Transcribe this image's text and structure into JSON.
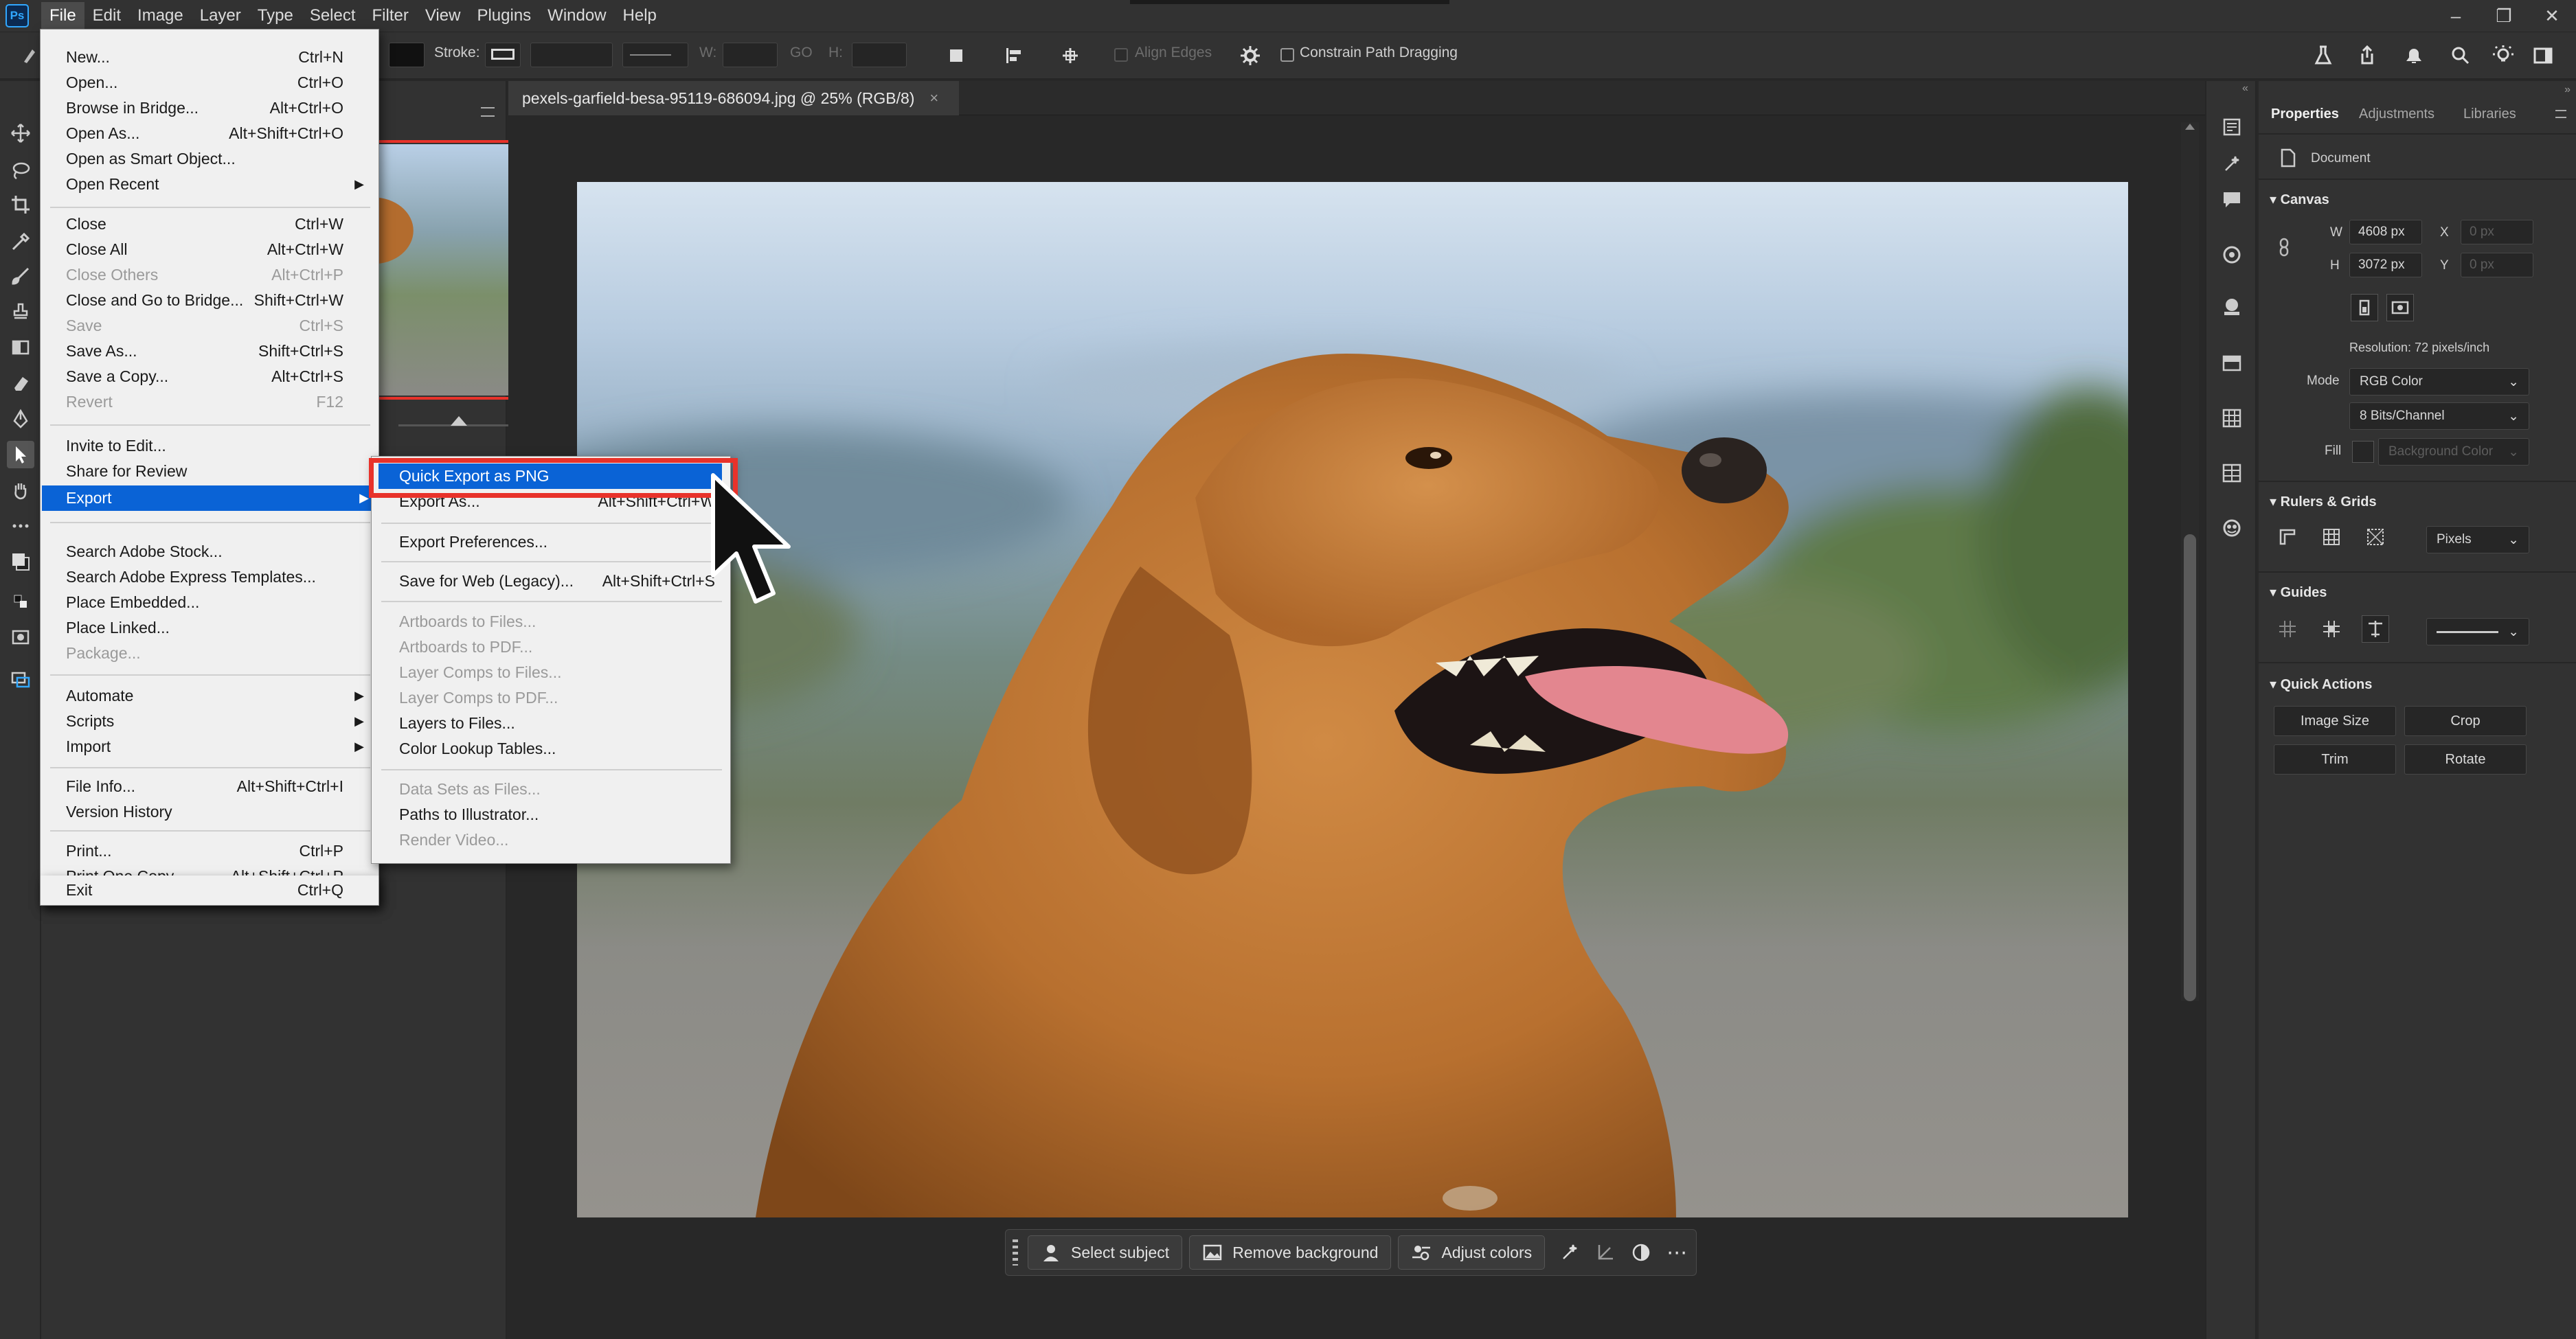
{
  "menubar": {
    "items": [
      "File",
      "Edit",
      "Image",
      "Layer",
      "Type",
      "Select",
      "Filter",
      "View",
      "Plugins",
      "Window",
      "Help"
    ]
  },
  "options_bar": {
    "stroke_label": "Stroke:",
    "w_label": "W:",
    "h_label": "H:",
    "align_edges": "Align Edges",
    "constrain_path": "Constrain Path Dragging"
  },
  "document": {
    "tab_title": "pexels-garfield-besa-95119-686094.jpg @ 25% (RGB/8)",
    "tab_close": "×"
  },
  "taskbar": {
    "select_subject": "Select subject",
    "remove_background": "Remove background",
    "adjust_colors": "Adjust colors",
    "more": "⋯"
  },
  "properties": {
    "tabs": [
      "Properties",
      "Adjustments",
      "Libraries"
    ],
    "document_label": "Document",
    "canvas_title": "Canvas",
    "w_label": "W",
    "w_value": "4608 px",
    "h_label": "H",
    "h_value": "3072 px",
    "x_label": "X",
    "x_value": "0 px",
    "y_label": "Y",
    "y_value": "0 px",
    "resolution": "Resolution: 72 pixels/inch",
    "mode_label": "Mode",
    "mode_value": "RGB Color",
    "bits_value": "8 Bits/Channel",
    "fill_label": "Fill",
    "fill_value": "Background Color",
    "rulers_title": "Rulers & Grids",
    "rulers_unit": "Pixels",
    "guides_title": "Guides",
    "quick_actions_title": "Quick Actions",
    "image_size": "Image Size",
    "crop": "Crop",
    "trim": "Trim",
    "rotate": "Rotate"
  },
  "file_menu": {
    "items": [
      {
        "label": "New...",
        "shortcut": "Ctrl+N"
      },
      {
        "label": "Open...",
        "shortcut": "Ctrl+O"
      },
      {
        "label": "Browse in Bridge...",
        "shortcut": "Alt+Ctrl+O"
      },
      {
        "label": "Open As...",
        "shortcut": "Alt+Shift+Ctrl+O"
      },
      {
        "label": "Open as Smart Object...",
        "shortcut": ""
      },
      {
        "label": "Open Recent",
        "shortcut": ""
      },
      {
        "label": "Close",
        "shortcut": "Ctrl+W"
      },
      {
        "label": "Close All",
        "shortcut": "Alt+Ctrl+W"
      },
      {
        "label": "Close Others",
        "shortcut": "Alt+Ctrl+P"
      },
      {
        "label": "Close and Go to Bridge...",
        "shortcut": "Shift+Ctrl+W"
      },
      {
        "label": "Save",
        "shortcut": "Ctrl+S"
      },
      {
        "label": "Save As...",
        "shortcut": "Shift+Ctrl+S"
      },
      {
        "label": "Save a Copy...",
        "shortcut": "Alt+Ctrl+S"
      },
      {
        "label": "Revert",
        "shortcut": "F12"
      },
      {
        "label": "Invite to Edit...",
        "shortcut": ""
      },
      {
        "label": "Share for Review",
        "shortcut": ""
      },
      {
        "label": "Export",
        "shortcut": ""
      },
      {
        "label": "Search Adobe Stock...",
        "shortcut": ""
      },
      {
        "label": "Search Adobe Express Templates...",
        "shortcut": ""
      },
      {
        "label": "Place Embedded...",
        "shortcut": ""
      },
      {
        "label": "Place Linked...",
        "shortcut": ""
      },
      {
        "label": "Package...",
        "shortcut": ""
      },
      {
        "label": "Automate",
        "shortcut": ""
      },
      {
        "label": "Scripts",
        "shortcut": ""
      },
      {
        "label": "Import",
        "shortcut": ""
      },
      {
        "label": "File Info...",
        "shortcut": "Alt+Shift+Ctrl+I"
      },
      {
        "label": "Version History",
        "shortcut": ""
      },
      {
        "label": "Print...",
        "shortcut": "Ctrl+P"
      },
      {
        "label": "Print One Copy",
        "shortcut": "Alt+Shift+Ctrl+P"
      },
      {
        "label": "Exit",
        "shortcut": "Ctrl+Q"
      }
    ]
  },
  "export_menu": {
    "items": [
      {
        "label": "Quick Export as PNG",
        "shortcut": ""
      },
      {
        "label": "Export As...",
        "shortcut": "Alt+Shift+Ctrl+W"
      },
      {
        "label": "Export Preferences...",
        "shortcut": ""
      },
      {
        "label": "Save for Web (Legacy)...",
        "shortcut": "Alt+Shift+Ctrl+S"
      },
      {
        "label": "Artboards to Files...",
        "shortcut": ""
      },
      {
        "label": "Artboards to PDF...",
        "shortcut": ""
      },
      {
        "label": "Layer Comps to Files...",
        "shortcut": ""
      },
      {
        "label": "Layer Comps to PDF...",
        "shortcut": ""
      },
      {
        "label": "Layers to Files...",
        "shortcut": ""
      },
      {
        "label": "Color Lookup Tables...",
        "shortcut": ""
      },
      {
        "label": "Data Sets as Files...",
        "shortcut": ""
      },
      {
        "label": "Paths to Illustrator...",
        "shortcut": ""
      },
      {
        "label": "Render Video...",
        "shortcut": ""
      }
    ]
  },
  "colors": {
    "menu_highlight": "#0a63d6",
    "annotation_red": "#e8322a",
    "ps_blue": "#31a8ff"
  }
}
